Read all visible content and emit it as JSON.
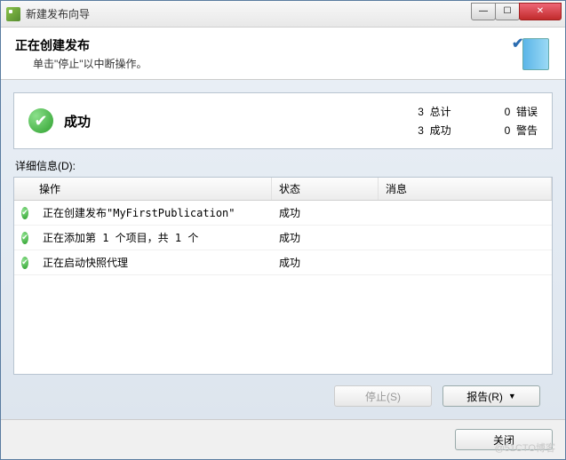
{
  "window": {
    "title": "新建发布向导"
  },
  "header": {
    "title": "正在创建发布",
    "subtitle": "单击\"停止\"以中断操作。"
  },
  "summary": {
    "status": "成功",
    "total_label": "总计",
    "total_value": "3",
    "success_label": "成功",
    "success_value": "3",
    "error_label": "错误",
    "error_value": "0",
    "warning_label": "警告",
    "warning_value": "0"
  },
  "details_label": "详细信息(D):",
  "columns": {
    "operation": "操作",
    "status": "状态",
    "message": "消息"
  },
  "rows": [
    {
      "operation": "正在创建发布\"MyFirstPublication\"",
      "status": "成功",
      "message": ""
    },
    {
      "operation": "正在添加第 1 个项目，共 1 个",
      "status": "成功",
      "message": ""
    },
    {
      "operation": "正在启动快照代理",
      "status": "成功",
      "message": ""
    }
  ],
  "buttons": {
    "stop": "停止(S)",
    "report": "报告(R)",
    "close": "关闭"
  },
  "watermark": "@51CTO博客"
}
